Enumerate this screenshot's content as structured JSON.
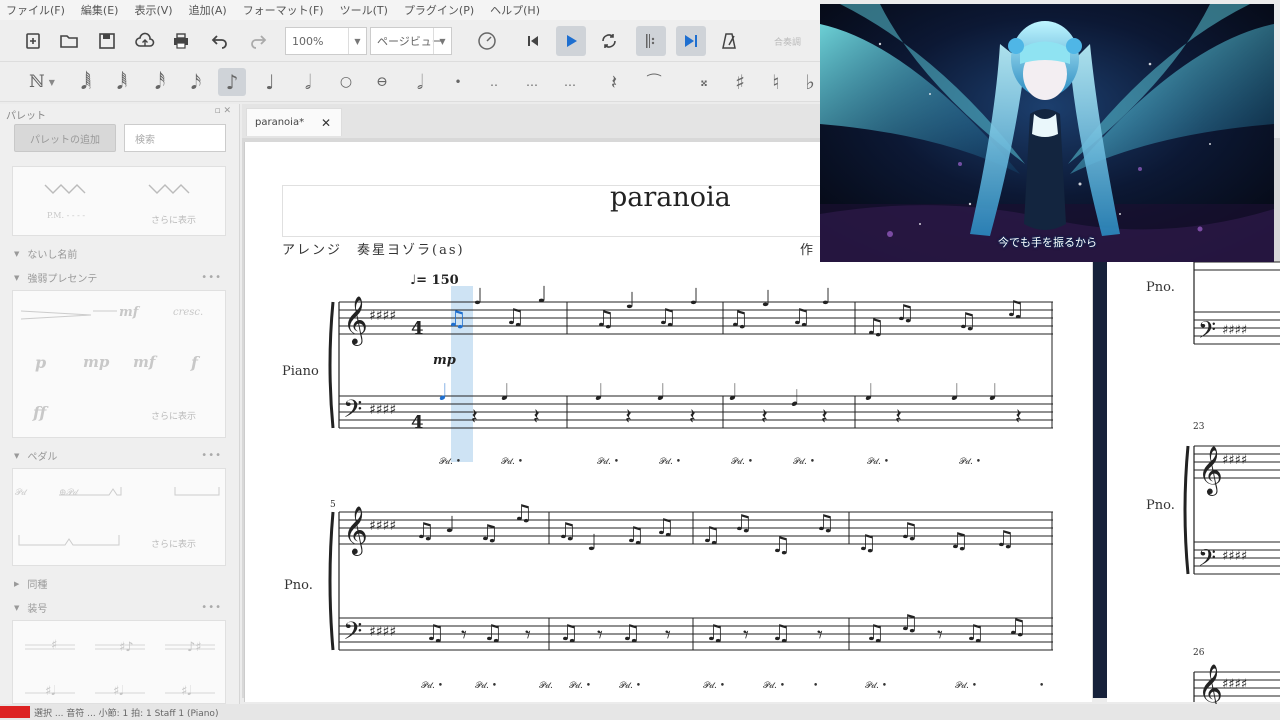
{
  "menu": [
    "ファイル(F)",
    "編集(E)",
    "表示(V)",
    "追加(A)",
    "フォーマット(F)",
    "ツール(T)",
    "プラグイン(P)",
    "ヘルプ(H)"
  ],
  "toolbar": {
    "zoom_value": "100%",
    "view_mode": "ページビュー",
    "concert_pitch": "合奏調"
  },
  "palette": {
    "title": "パレット",
    "add_button": "パレットの追加",
    "search_placeholder": "検索",
    "sections": [
      "ないし名前",
      "強弱プレセンテ",
      "ペダル",
      "同種",
      "装号"
    ],
    "more_label": "さらに表示",
    "dynamics": [
      "p",
      "mp",
      "mf",
      "f",
      "ff"
    ],
    "line_labels": [
      "P.M. - - - -",
      "mf",
      "cresc."
    ]
  },
  "tab": {
    "label": "paranoia*"
  },
  "score": {
    "title": "paranoia",
    "arranger": "アレンジ　奏星ヨゾラ(as)",
    "composer": "作",
    "instrument_full": "Piano",
    "instrument_short": "Pno.",
    "tempo": "♩= 150",
    "dynamic": "mp",
    "measure_numbers": [
      "5",
      "23",
      "26"
    ]
  },
  "video": {
    "caption": "今でも手を振るから"
  },
  "status": {
    "text": "選択 ... 音符 ... 小節: 1 拍: 1 Staff 1 (Piano)"
  },
  "colors": {
    "accent": "#1e6fd0",
    "page_separator": "#16213a",
    "selection": "#9ec7ea"
  }
}
